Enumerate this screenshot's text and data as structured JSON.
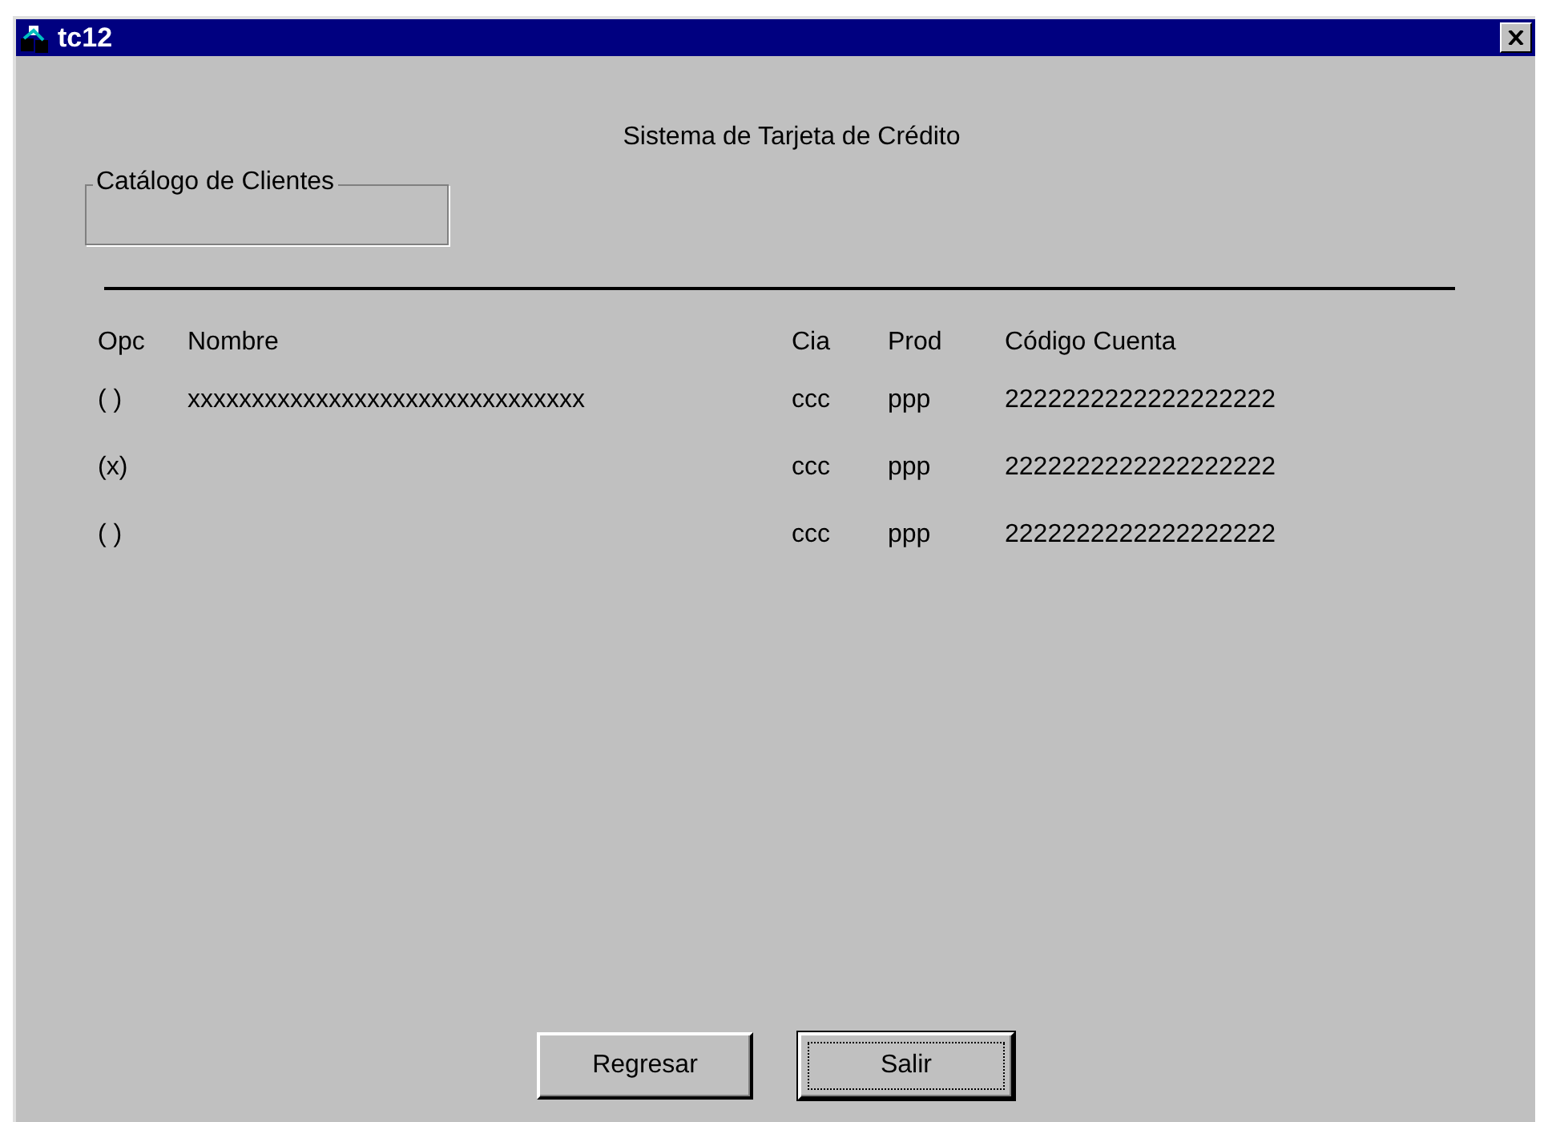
{
  "window": {
    "title": "tc12"
  },
  "heading": "Sistema de Tarjeta de Crédito",
  "group": {
    "label": "Catálogo de Clientes"
  },
  "table": {
    "columns": [
      "Opc",
      "Nombre",
      "Cia",
      "Prod",
      "Código Cuenta"
    ],
    "rows": [
      {
        "cells": [
          "( )",
          "xxxxxxxxxxxxxxxxxxxxxxxxxxxxxxx",
          "ccc",
          "ppp",
          "2222222222222222222"
        ]
      },
      {
        "cells": [
          "(x)",
          "",
          "ccc",
          "ppp",
          "2222222222222222222"
        ]
      },
      {
        "cells": [
          "( )",
          "",
          "ccc",
          "ppp",
          "2222222222222222222"
        ]
      }
    ]
  },
  "buttons": [
    {
      "label": "Regresar",
      "default": false
    },
    {
      "label": "Salir",
      "default": true
    }
  ]
}
